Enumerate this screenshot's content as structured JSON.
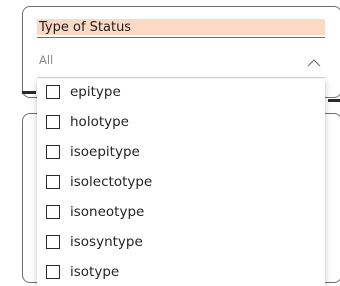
{
  "slicer": {
    "title": "Type of Status",
    "selected_value": "All",
    "chevron_icon": "chevron-up-icon",
    "options": [
      {
        "label": "epitype",
        "checked": false
      },
      {
        "label": "holotype",
        "checked": false
      },
      {
        "label": "isoepitype",
        "checked": false
      },
      {
        "label": "isolectotype",
        "checked": false
      },
      {
        "label": "isoneotype",
        "checked": false
      },
      {
        "label": "isosyntype",
        "checked": false
      },
      {
        "label": "isotype",
        "checked": false
      }
    ]
  },
  "colors": {
    "title_band": "#fbd9c4",
    "border": "#6e6e6e",
    "text": "#252423"
  }
}
